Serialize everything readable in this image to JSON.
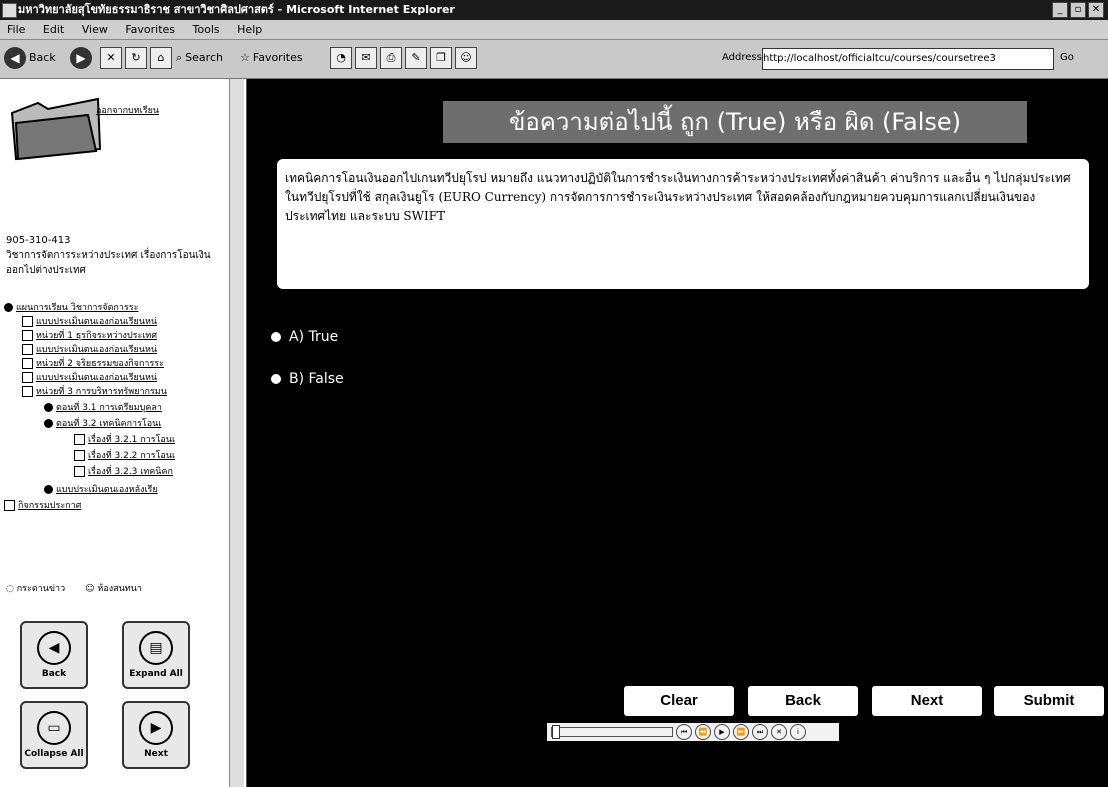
{
  "window": {
    "title": "มหาวิทยาลัยสุโขทัยธรรมาธิราช สาขาวิชาศิลปศาสตร์ - Microsoft Internet Explorer",
    "buttons": [
      "_",
      "▫",
      "✕"
    ]
  },
  "menu": [
    "File",
    "Edit",
    "View",
    "Favorites",
    "Tools",
    "Help"
  ],
  "toolbar": {
    "back": "Back",
    "search": "Search",
    "favorites": "Favorites",
    "address_label": "Address",
    "address_value": "http://localhost/officialtcu/courses/coursetree3",
    "go": "Go"
  },
  "sidebar": {
    "exit_label": "ออกจากบทเรียน",
    "course_code": "905-310-413",
    "course_title": "วิชาการจัดการระหว่างประเทศ เรื่องการโอนเงินออกไปต่างประเทศ",
    "tree": [
      "แผนการเรียน วิชาการจัดการระ",
      "แบบประเมินตนเองก่อนเรียนหน่",
      "หน่วยที่ 1 ธุรกิจระหว่างประเทศ",
      "แบบประเมินตนเองก่อนเรียนหน่",
      "หน่วยที่ 2 จริยธรรมของกิจการระ",
      "แบบประเมินตนเองก่อนเรียนหน่",
      "หน่วยที่ 3 การบริหารทรัพยากรมน",
      "ตอนที่ 3.1 การเตรียมบุคลา",
      "ตอนที่ 3.2 เทคนิคการโอนเ",
      "เรื่องที่ 3.2.1 การโอนเ",
      "เรื่องที่ 3.2.2 การโอนเ",
      "เรื่องที่ 3.2.3 เทคนิคก",
      "แบบประเมินตนเองหลังเรีย",
      "กิจกรรมประกาศ"
    ],
    "links": [
      "กระดานข่าว",
      "ห้องสนทนา"
    ],
    "buttons": {
      "back": "Back",
      "expand_all": "Expand All",
      "collapse_all": "Collapse All",
      "next": "Next"
    }
  },
  "quiz": {
    "heading": "ข้อความต่อไปนี้ ถูก (True) หรือ ผิด (False)",
    "question": "เทคนิคการโอนเงินออกไปเกนทวีปยุโรป หมายถึง แนวทางปฏิบัติในการชำระเงินทางการค้าระหว่างประเทศทั้งค่าสินค้า ค่าบริการ และอื่น ๆ ไปกลุ่มประเทศในทวีปยุโรปที่ใช้ สกุลเงินยูโร (EURO Currency) การจัดการการชำระเงินระหว่างประเทศ ให้สอดคล้องกับกฎหมายควบคุมการแลกเปลี่ยนเงินของประเทศไทย และระบบ SWIFT",
    "options": [
      "A) True",
      "B) False"
    ],
    "buttons": {
      "clear": "Clear",
      "back": "Back",
      "next": "Next",
      "submit": "Submit"
    }
  }
}
